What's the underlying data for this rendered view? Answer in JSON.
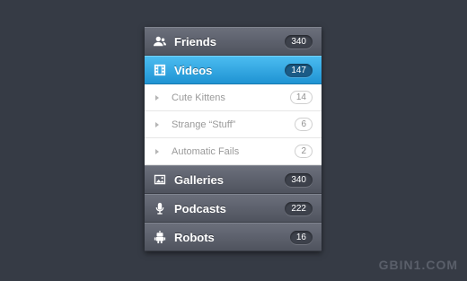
{
  "menu": {
    "items": [
      {
        "label": "Friends",
        "count": "340",
        "icon": "users-icon"
      },
      {
        "label": "Videos",
        "count": "147",
        "icon": "film-icon",
        "active": true
      },
      {
        "label": "Galleries",
        "count": "340",
        "icon": "image-icon"
      },
      {
        "label": "Podcasts",
        "count": "222",
        "icon": "microphone-icon"
      },
      {
        "label": "Robots",
        "count": "16",
        "icon": "robot-icon"
      }
    ],
    "subitems": [
      {
        "label": "Cute Kittens",
        "count": "14"
      },
      {
        "label": "Strange “Stuff”",
        "count": "6"
      },
      {
        "label": "Automatic Fails",
        "count": "2"
      }
    ]
  },
  "colors": {
    "background": "#363b45",
    "active": "#2aa6e3",
    "item": "#5d616c"
  },
  "watermark": "GBIN1.COM"
}
